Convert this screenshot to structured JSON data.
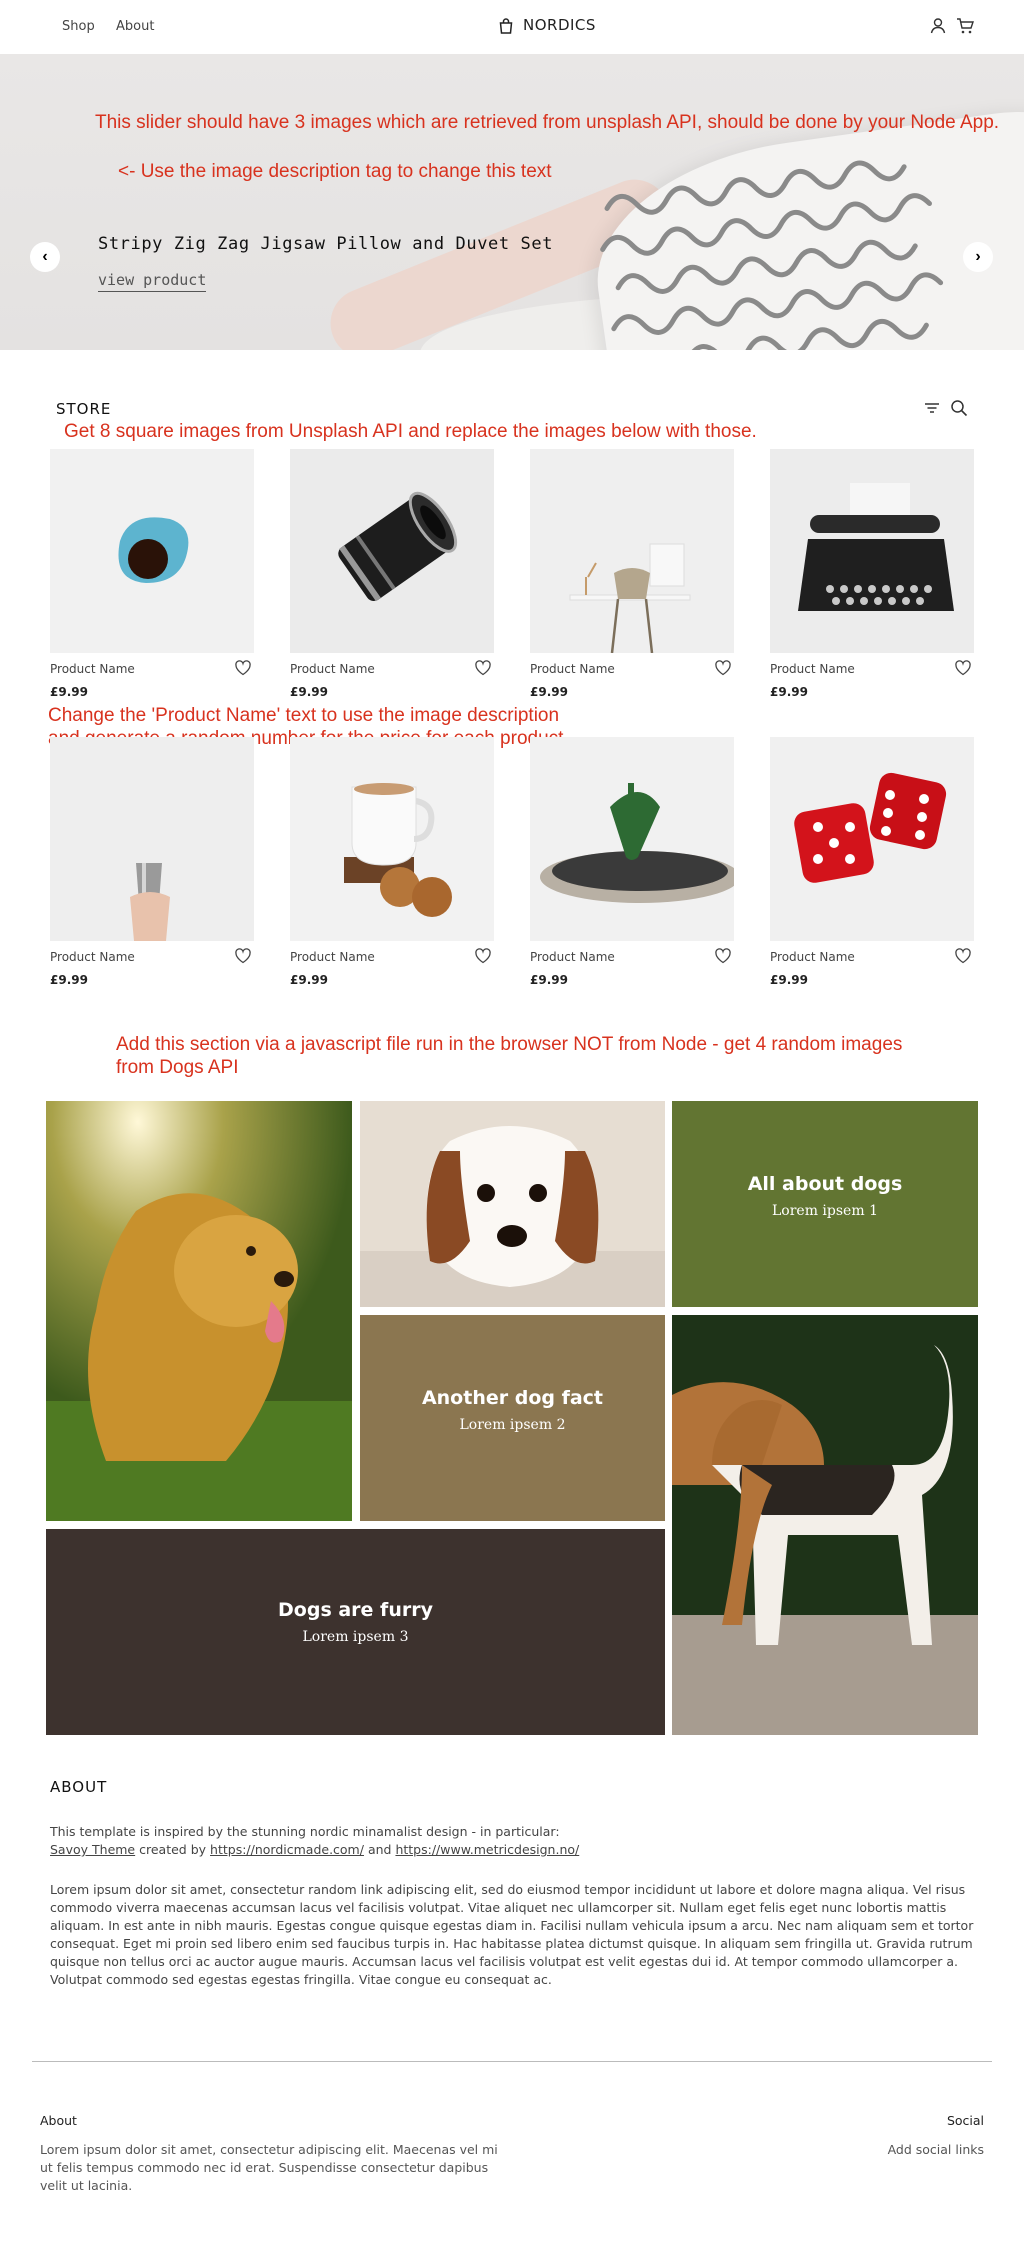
{
  "nav": {
    "links": [
      "Shop",
      "About"
    ],
    "brand": "NORDICS",
    "icons": [
      "bag-icon",
      "user-icon",
      "cart-icon"
    ]
  },
  "hero": {
    "note_api": "This slider should have 3 images which are retrieved from unsplash API, should be done by your Node App.",
    "note_desc": "<- Use the image description tag to change this text",
    "title": "Stripy Zig Zag Jigsaw Pillow and Duvet Set",
    "link": "view product",
    "prev": "‹",
    "next": "›",
    "slides_total": 3,
    "active_slide": 1
  },
  "store": {
    "title": "STORE",
    "note_images": "Get 8 square images from Unsplash API and replace the images below with those.",
    "note_names": "Change the 'Product Name' text to use the image description\nand generate a random number for the price for each product",
    "products": [
      {
        "name": "Product Name",
        "price": "£9.99",
        "image": "blue-coffee-cup"
      },
      {
        "name": "Product Name",
        "price": "£9.99",
        "image": "camera-lens"
      },
      {
        "name": "Product Name",
        "price": "£9.99",
        "image": "desk-and-chair"
      },
      {
        "name": "Product Name",
        "price": "£9.99",
        "image": "typewriter"
      },
      {
        "name": "Product Name",
        "price": "£9.99",
        "image": "hand-holding-cup"
      },
      {
        "name": "Product Name",
        "price": "£9.99",
        "image": "tea-and-cookies"
      },
      {
        "name": "Product Name",
        "price": "£9.99",
        "image": "spinning-top"
      },
      {
        "name": "Product Name",
        "price": "£9.99",
        "image": "red-dice"
      }
    ]
  },
  "dogs": {
    "note": "Add this section via a javascript file run in the browser NOT from Node - get 4 random images\nfrom Dogs API",
    "facts": [
      {
        "heading": "All about dogs",
        "sub": "Lorem ipsem 1",
        "color": "#627532"
      },
      {
        "heading": "Another dog fact",
        "sub": "Lorem ipsem 2",
        "color": "#8b7650"
      },
      {
        "heading": "Dogs are furry",
        "sub": "Lorem ipsem 3",
        "color": "#3d322e"
      }
    ],
    "images": [
      "golden-retriever",
      "cavalier-spaniel",
      "beagle"
    ]
  },
  "about": {
    "title": "ABOUT",
    "intro": "This template is inspired by the stunning nordic minamalist design - in particular:",
    "link1": "Savoy Theme",
    "created_by": "created by",
    "link2": "https://nordicmade.com/",
    "and": "and",
    "link3": "https://www.metricdesign.no/",
    "body": "Lorem ipsum dolor sit amet, consectetur random link adipiscing elit, sed do eiusmod tempor incididunt ut labore et dolore magna aliqua. Vel risus commodo viverra maecenas accumsan lacus vel facilisis volutpat. Vitae aliquet nec ullamcorper sit. Nullam eget felis eget nunc lobortis mattis aliquam. In est ante in nibh mauris. Egestas congue quisque egestas diam in. Facilisi nullam vehicula ipsum a arcu. Nec nam aliquam sem et tortor consequat. Eget mi proin sed libero enim sed faucibus turpis in. Hac habitasse platea dictumst quisque. In aliquam sem fringilla ut. Gravida rutrum quisque non tellus orci ac auctor augue mauris. Accumsan lacus vel facilisis volutpat est velit egestas dui id. At tempor commodo ullamcorper a. Volutpat commodo sed egestas egestas fringilla. Vitae congue eu consequat ac."
  },
  "footer": {
    "about_title": "About",
    "about_text": "Lorem ipsum dolor sit amet, consectetur adipiscing elit. Maecenas vel mi ut felis tempus commodo nec id erat. Suspendisse consectetur dapibus velit ut lacinia.",
    "social_title": "Social",
    "social_text": "Add social links"
  },
  "colors": {
    "note_red": "#d8321e",
    "text": "#333333"
  }
}
